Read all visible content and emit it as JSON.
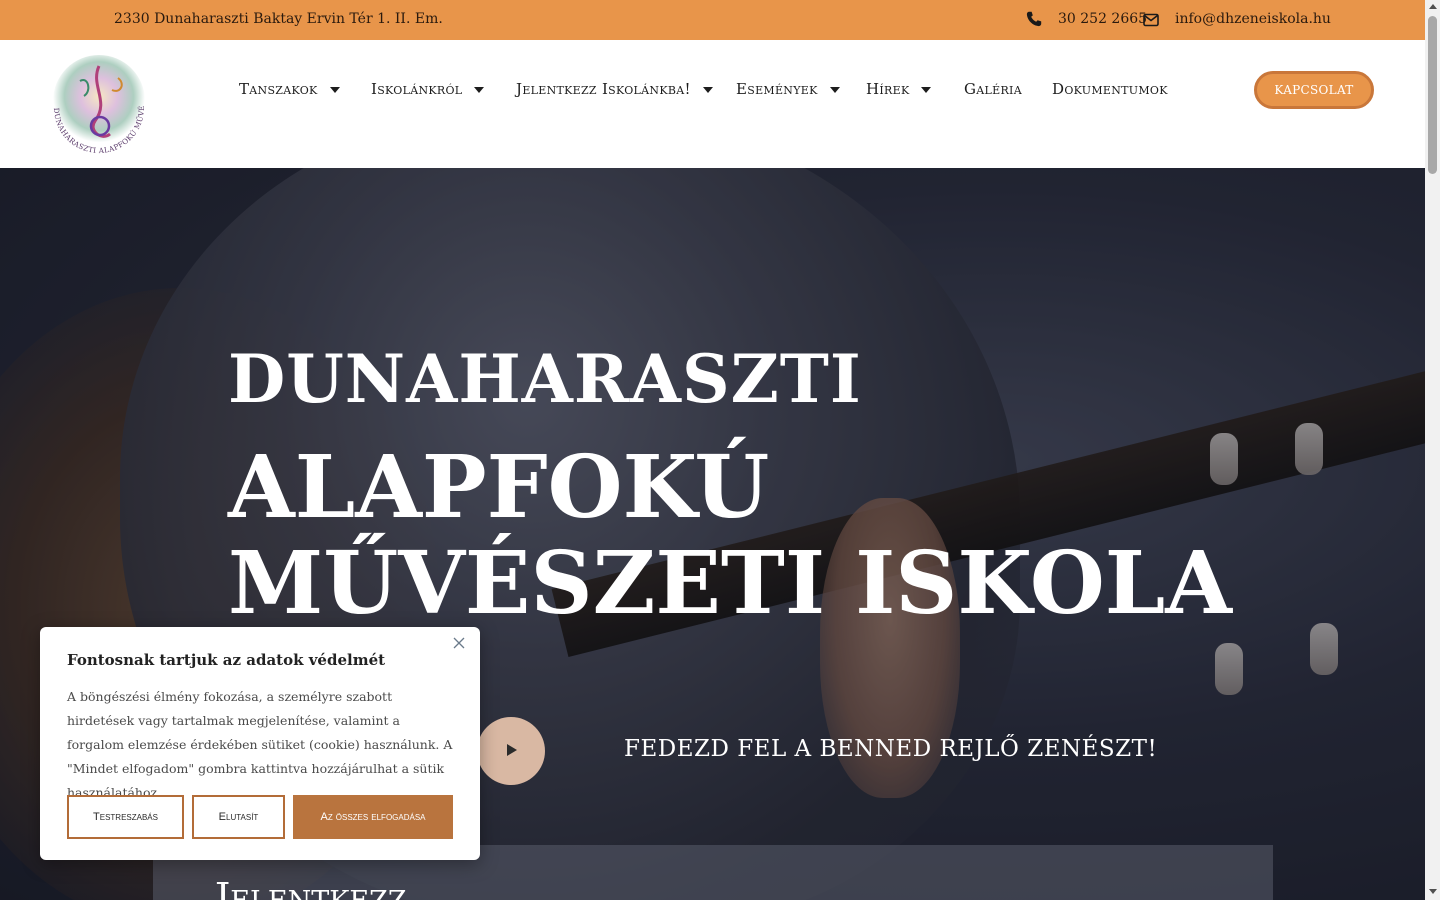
{
  "topbar": {
    "address": "2330 Dunaharaszti Baktay Ervin Tér 1. II. Em.",
    "phone": "30 252 2665",
    "email": "info@dhzeneiskola.hu",
    "phone_icon": "phone-icon",
    "email_icon": "envelope-icon"
  },
  "header": {
    "logo_text": "DUNAHARASZTI ALAPFOKÚ MŰVÉSZETI ISKOLA",
    "nav": [
      {
        "label": "Tanszakok",
        "has_dropdown": true
      },
      {
        "label": "Iskolánkról",
        "has_dropdown": true
      },
      {
        "label": "Jelentkezz Iskolánkba!",
        "has_dropdown": true
      },
      {
        "label": "Események",
        "has_dropdown": true
      },
      {
        "label": "Hírek",
        "has_dropdown": true
      },
      {
        "label": "Galéria",
        "has_dropdown": false
      },
      {
        "label": "Dokumentumok",
        "has_dropdown": false
      }
    ],
    "contact_button": "KAPCSOLAT"
  },
  "hero": {
    "title_line1": "DUNAHARASZTI",
    "title_line2": "ALAPFOKÚ",
    "title_line3": "MŰVÉSZETI ISKOLA",
    "tagline": "FEDEZD FEL A BENNED REJLŐ ZENÉSZT!",
    "box_title": "Jelentkezz"
  },
  "cookie": {
    "title": "Fontosnak tartjuk az adatok védelmét",
    "text": "A böngészési élmény fokozása, a személyre szabott hirdetések vagy tartalmak megjelenítése, valamint a forgalom elemzése érdekében sütiket (cookie) használunk. A \"Mindet elfogadom\" gombra kattintva hozzájárulhat a sütik használatához.",
    "customize_label": "Testreszabás",
    "reject_label": "Elutasít",
    "accept_label": "Az összes elfogadása"
  },
  "colors": {
    "accent": "#E8954A",
    "button_dark": "#B9743E",
    "text_dark": "#1D1D1D"
  }
}
